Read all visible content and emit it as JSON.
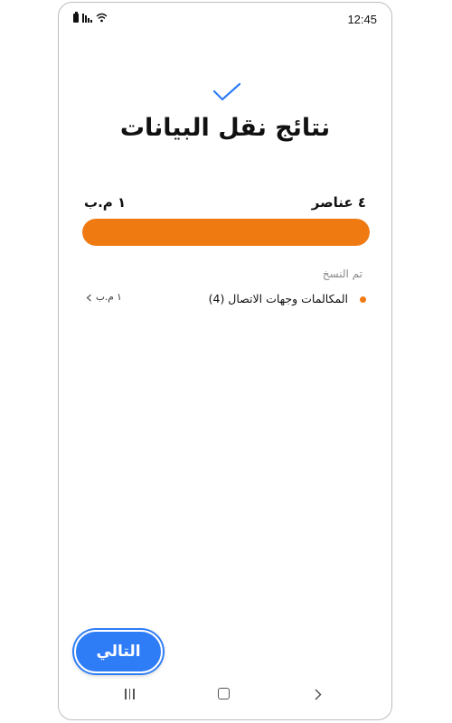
{
  "status_bar": {
    "time": "12:45"
  },
  "header": {
    "title": "نتائج نقل البيانات"
  },
  "summary": {
    "items_label": "٤ عناصر",
    "size_label": "١ م.ب",
    "progress_fraction": 1.0
  },
  "section": {
    "label": "تم النسخ"
  },
  "categories": [
    {
      "name": "المكالمات وجهات الاتصال (4)",
      "size": "١ م.ب"
    }
  ],
  "buttons": {
    "next_label": "التالي"
  },
  "colors": {
    "accent": "#f07a12",
    "button": "#2f7df6",
    "check": "#2f7df6"
  }
}
